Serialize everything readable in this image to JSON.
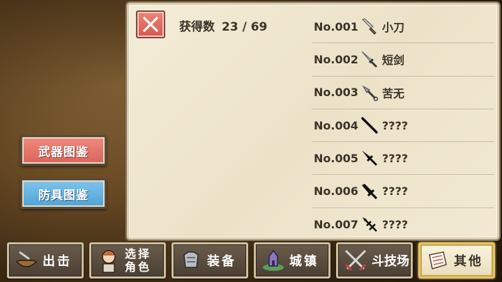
{
  "side_menu": {
    "weapon_label": "武器图鉴",
    "armor_label": "防具图鉴"
  },
  "panel": {
    "count_label": "获得数",
    "count_value": "23 / 69",
    "items": [
      {
        "no": "No.001",
        "name": "小刀",
        "icon": "knife-icon"
      },
      {
        "no": "No.002",
        "name": "短剑",
        "icon": "short-sword-icon"
      },
      {
        "no": "No.003",
        "name": "苦无",
        "icon": "kunai-icon"
      },
      {
        "no": "No.004",
        "name": "????",
        "icon": "unknown-blade-icon"
      },
      {
        "no": "No.005",
        "name": "????",
        "icon": "unknown-sword-icon"
      },
      {
        "no": "No.006",
        "name": "????",
        "icon": "unknown-broadsword-icon"
      },
      {
        "no": "No.007",
        "name": "????",
        "icon": "unknown-hilt-icon"
      }
    ]
  },
  "nav": {
    "sortie": "出击",
    "select_line1": "选择",
    "select_line2": "角色",
    "equip": "装备",
    "town": "城镇",
    "arena": "斗技场",
    "other": "其他"
  },
  "colors": {
    "weapon_button": "#e2716a",
    "armor_button": "#62b2e0",
    "close_button": "#e36c60",
    "panel_bg": "#f1e8d2",
    "active_nav_border": "#e2c56a"
  }
}
